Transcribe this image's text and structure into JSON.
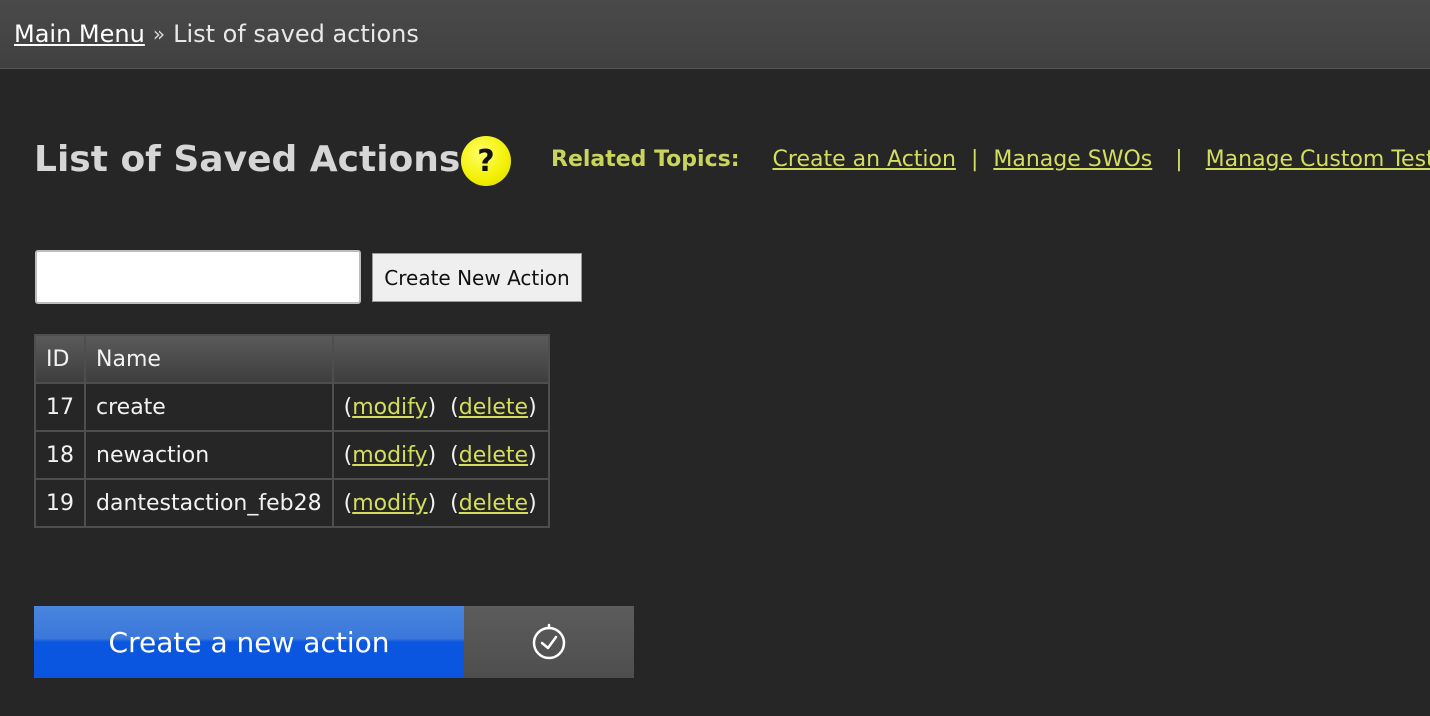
{
  "breadcrumb": {
    "home_link": "Main Menu",
    "separator": "»",
    "current": "List of saved actions"
  },
  "page": {
    "title": "List of Saved Actions",
    "help_icon_glyph": "?"
  },
  "related_topics": {
    "label": "Related Topics:",
    "links": [
      "Create an Action",
      "Manage SWOs",
      "Manage Custom Tests"
    ],
    "separator": "|"
  },
  "create_form": {
    "input_value": "",
    "input_placeholder": "",
    "button_label": "Create New Action"
  },
  "table": {
    "headers": [
      "ID",
      "Name",
      ""
    ],
    "rows": [
      {
        "id": "17",
        "name": "create",
        "modify": "modify",
        "delete": "delete"
      },
      {
        "id": "18",
        "name": "newaction",
        "modify": "modify",
        "delete": "delete"
      },
      {
        "id": "19",
        "name": "dantestaction_feb28",
        "modify": "modify",
        "delete": "delete"
      }
    ],
    "paren_open": "(",
    "paren_close": ")"
  },
  "footer": {
    "new_action_button": "Create a new action",
    "timer_icon": "clock-icon"
  },
  "colors": {
    "background": "#262626",
    "link": "#d4de5e",
    "primary_button": "#0a56e0",
    "help_icon": "#f2f000"
  }
}
